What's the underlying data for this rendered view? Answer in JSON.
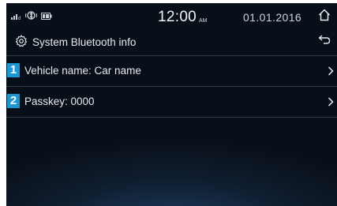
{
  "status_bar": {
    "icons": [
      "signal-icon",
      "bluetooth-icon",
      "battery-icon"
    ],
    "time": "12:00",
    "ampm": "AM",
    "date": "01.01.2016"
  },
  "header": {
    "title": "System Bluetooth info",
    "icon": "gear-icon"
  },
  "items": [
    {
      "badge": "1",
      "label": "Vehicle name: Car name"
    },
    {
      "badge": "2",
      "label": "Passkey: 0000"
    }
  ],
  "colors": {
    "accent": "#1a98d5",
    "background": "#0f1e30"
  }
}
